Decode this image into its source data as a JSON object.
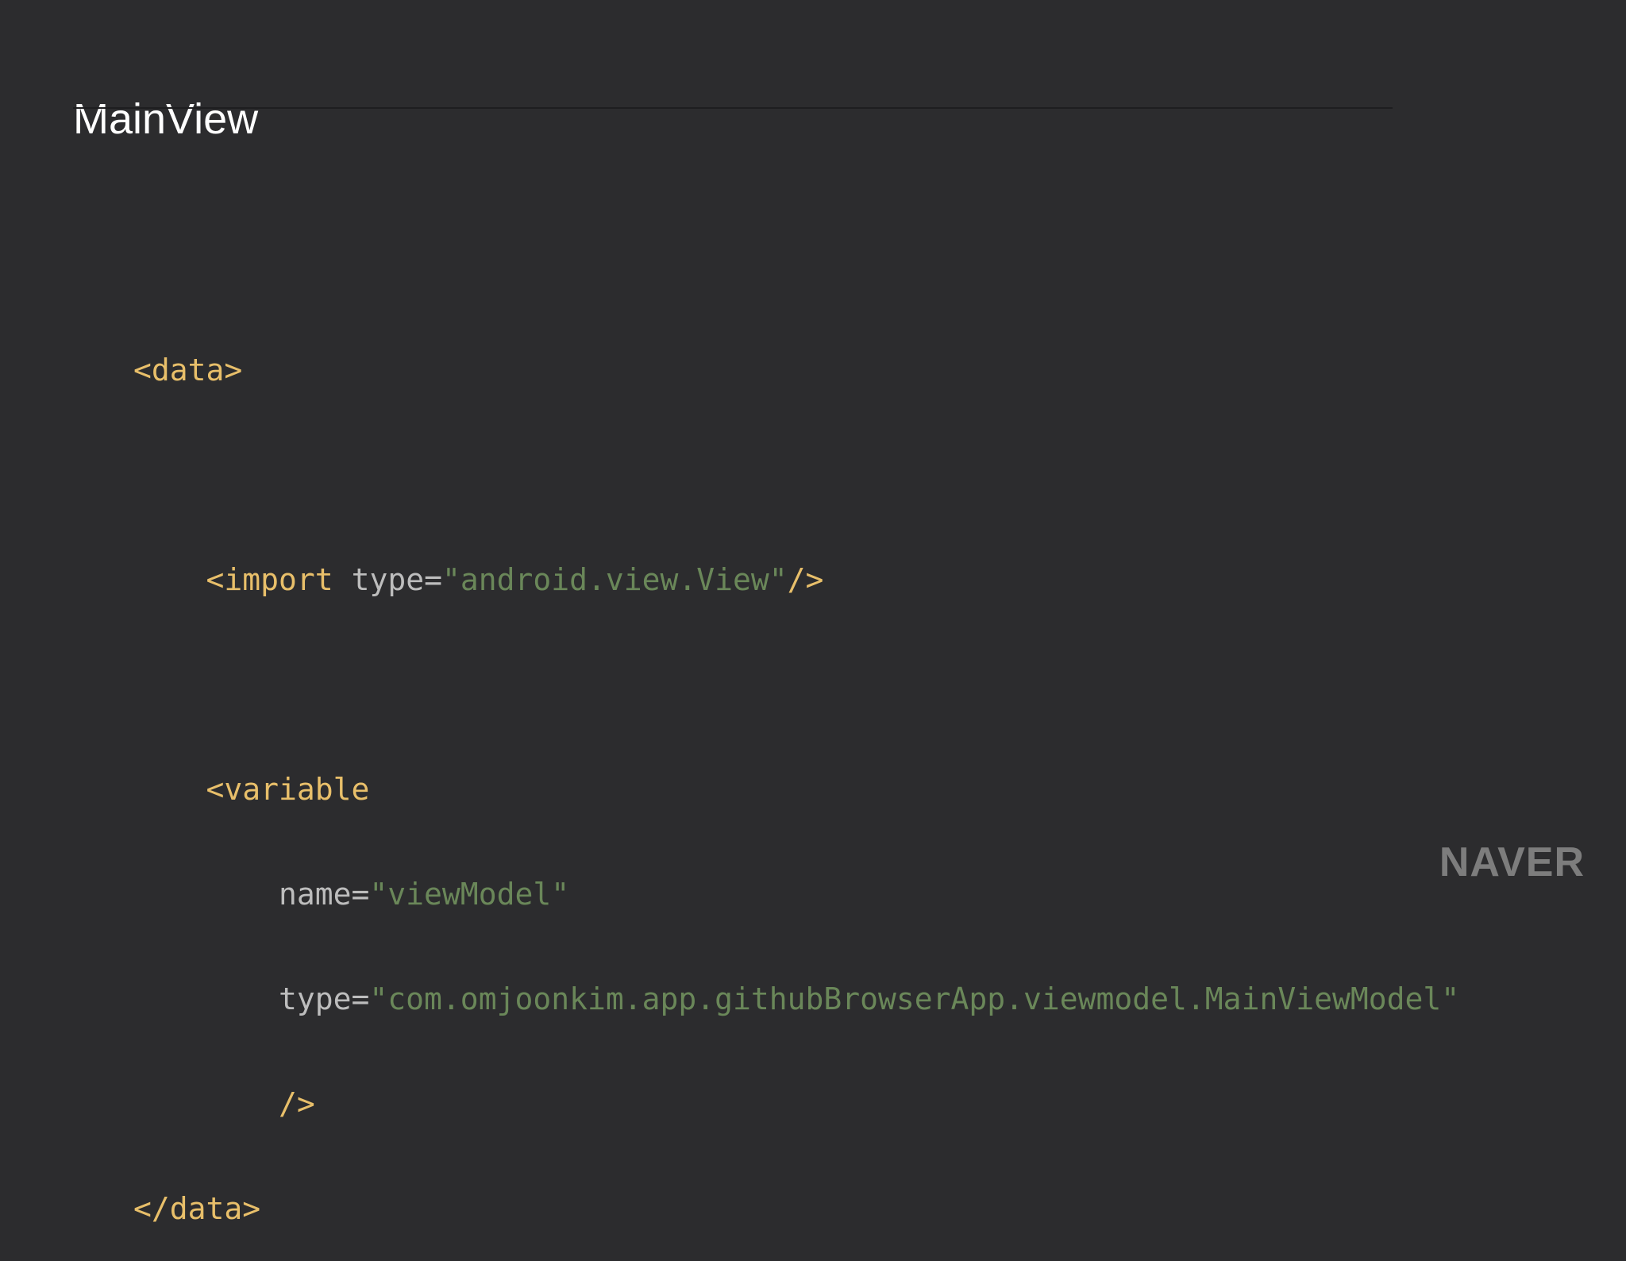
{
  "slide": {
    "title": "MainView"
  },
  "code": {
    "line1": {
      "open": "<data>"
    },
    "line3": {
      "indent": "    ",
      "tag": "<import",
      "space": " ",
      "attr": "type=",
      "value": "\"android.view.View\"",
      "close": "/>"
    },
    "line5": {
      "indent": "    ",
      "tag": "<variable"
    },
    "line6": {
      "indent": "        ",
      "attr": "name=",
      "value": "\"viewModel\""
    },
    "line7": {
      "indent": "        ",
      "attr": "type=",
      "value": "\"com.omjoonkim.app.githubBrowserApp.viewmodel.MainViewModel\""
    },
    "line8": {
      "indent": "        ",
      "close": "/>"
    },
    "line9": {
      "close": "</data>"
    }
  },
  "brand": {
    "logo_text": "NAVER"
  },
  "colors": {
    "background": "#2c2c2e",
    "tag": "#e8bf6a",
    "attribute": "#bdbdbd",
    "string": "#6a8759"
  }
}
